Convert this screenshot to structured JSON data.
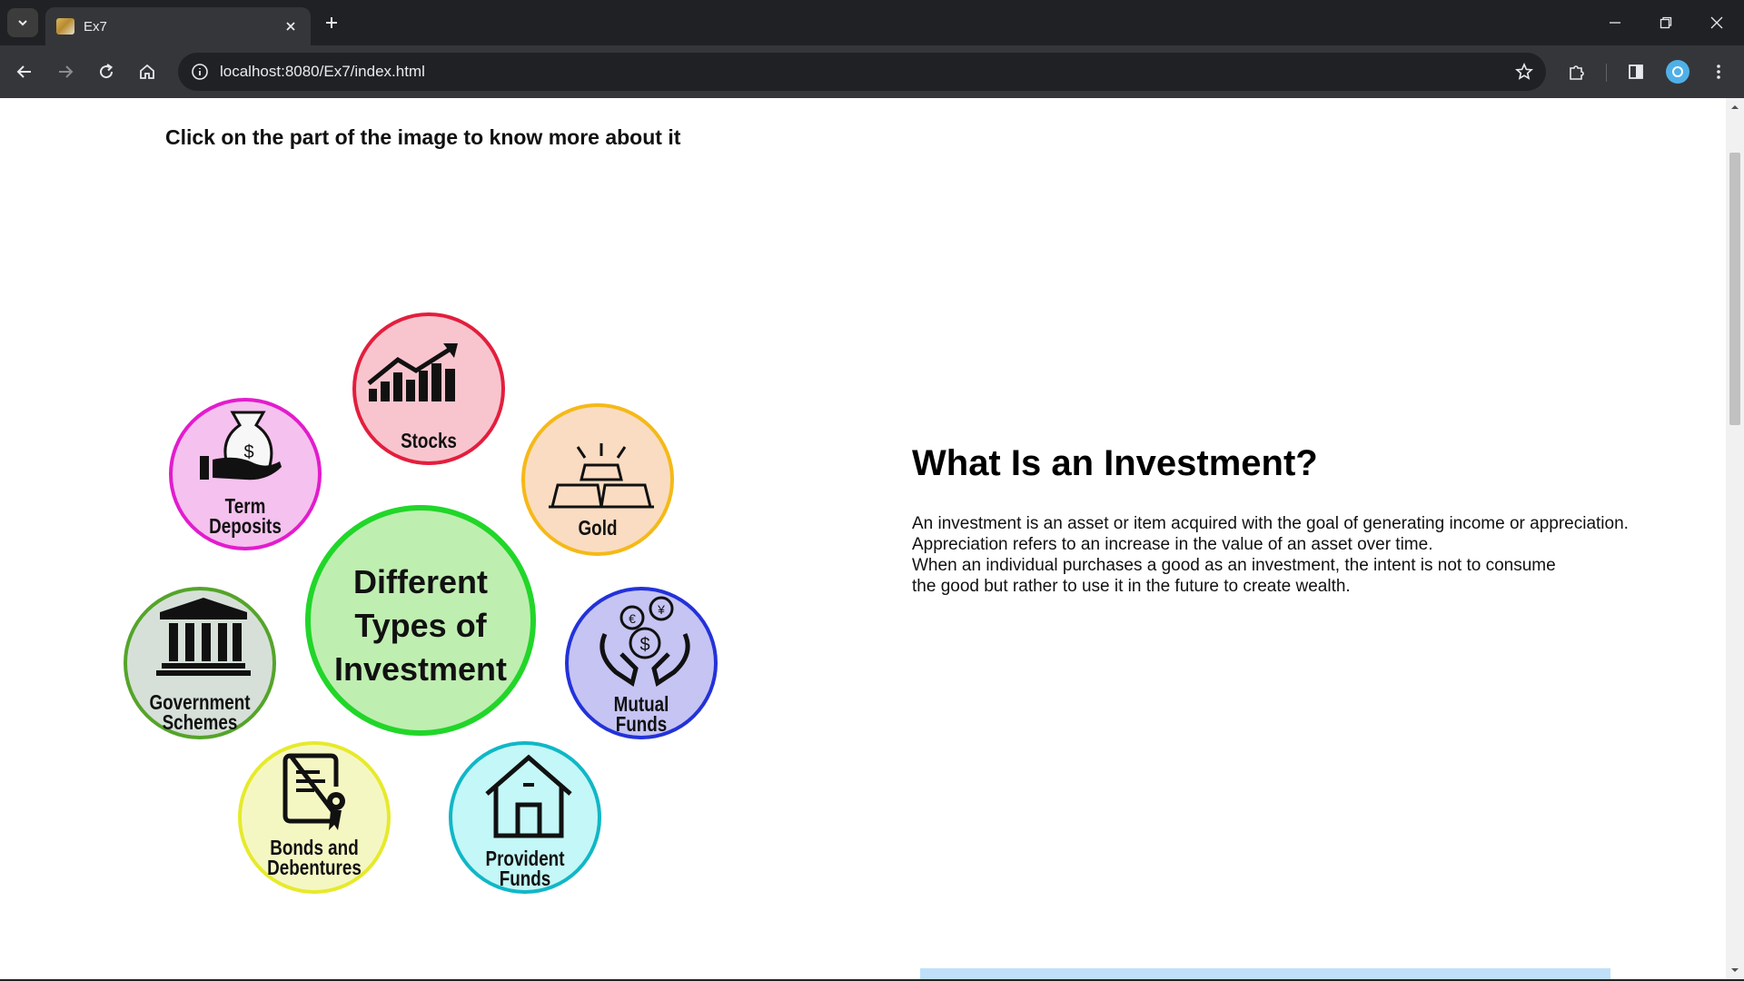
{
  "browser": {
    "tab_title": "Ex7",
    "url": "localhost:8080/Ex7/index.html",
    "icons": {
      "tab_dropdown": "chevron-down-icon",
      "tab_close": "close-icon",
      "new_tab": "plus-icon",
      "back": "back-arrow-icon",
      "forward": "forward-arrow-icon",
      "reload": "reload-icon",
      "home": "home-icon",
      "site_info": "info-icon",
      "bookmark": "star-icon",
      "extensions": "puzzle-icon",
      "side_panel": "side-panel-icon",
      "menu": "kebab-menu-icon"
    }
  },
  "page": {
    "instruction": "Click on the part of the image to know more about it",
    "diagram": {
      "center_lines": [
        "Different",
        "Types of",
        "Investment"
      ],
      "items": [
        {
          "id": "stocks",
          "lines": [
            "Stocks"
          ],
          "fill": "#f8c5ce",
          "border": "#e31e3d",
          "icon": "bar-chart-up-icon"
        },
        {
          "id": "term-deposits",
          "lines": [
            "Term",
            "Deposits"
          ],
          "fill": "#f5c1ee",
          "border": "#e21ccd",
          "icon": "money-bag-hand-icon"
        },
        {
          "id": "gold",
          "lines": [
            "Gold"
          ],
          "fill": "#fadcc2",
          "border": "#f5b917",
          "icon": "gold-bars-icon"
        },
        {
          "id": "government-schemes",
          "lines": [
            "Government",
            "Schemes"
          ],
          "fill": "#d6e0d8",
          "border": "#55a42a",
          "icon": "bank-building-icon"
        },
        {
          "id": "mutual-funds",
          "lines": [
            "Mutual",
            "Funds"
          ],
          "fill": "#c6c4f3",
          "border": "#2332d9",
          "icon": "hands-coins-icon"
        },
        {
          "id": "bonds-debentures",
          "lines": [
            "Bonds and",
            "Debentures"
          ],
          "fill": "#f5f7c3",
          "border": "#e6ea2b",
          "icon": "certificate-icon"
        },
        {
          "id": "provident-funds",
          "lines": [
            "Provident",
            "Funds"
          ],
          "fill": "#c4f7f7",
          "border": "#10b7c6",
          "icon": "house-icon"
        }
      ],
      "center_fill": "#bfeeb1",
      "center_border": "#21d629"
    },
    "info": {
      "heading": "What Is an Investment?",
      "lines": [
        "An investment is an asset or item acquired with the goal of generating income or appreciation.",
        "Appreciation refers to an increase in the value of an asset over time.",
        "When an individual purchases a good as an investment, the intent is not to consume",
        "the good but rather to use it in the future to create wealth."
      ]
    }
  }
}
